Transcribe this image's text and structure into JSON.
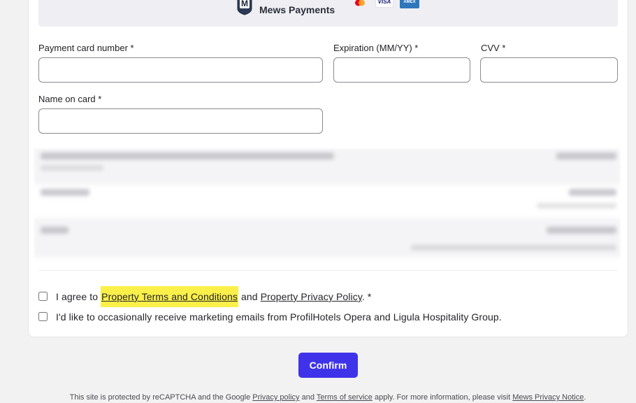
{
  "brand": {
    "name": "Mews Payments",
    "logo_letter": "M",
    "card_brands": [
      "mastercard-icon",
      "VISA",
      "AMEX"
    ]
  },
  "form": {
    "card_number_label": "Payment card number *",
    "expiration_label": "Expiration (MM/YY) *",
    "cvv_label": "CVV *",
    "name_label": "Name on card *",
    "card_number_value": "",
    "expiration_value": "",
    "cvv_value": "",
    "name_value": ""
  },
  "agreements": {
    "terms_prefix": "I agree to",
    "terms_link": "Property Terms and Conditions",
    "terms_and": "and",
    "privacy_link": "Property Privacy Policy",
    "terms_suffix": ". *",
    "marketing_text": "I'd like to occasionally receive marketing emails from ProfilHotels Opera and Ligula Hospitality Group."
  },
  "actions": {
    "confirm_label": "Confirm"
  },
  "footer": {
    "prefix": "This site is protected by reCAPTCHA and the Google",
    "privacy_link": "Privacy policy",
    "and": "and",
    "terms_link": "Terms of service",
    "middle": "apply. For more information, please visit",
    "mews_link": "Mews Privacy Notice",
    "suffix": "."
  },
  "colors": {
    "accent": "#3f33ea",
    "highlight": "#fbf04a"
  }
}
